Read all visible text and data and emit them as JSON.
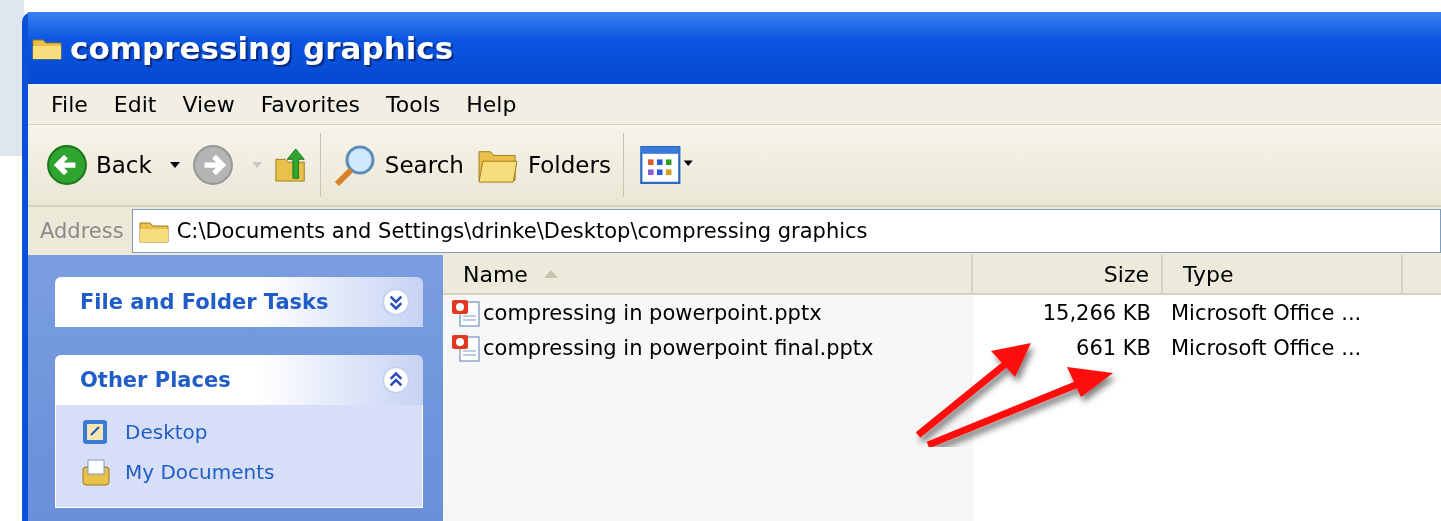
{
  "window": {
    "title": "compressing graphics"
  },
  "menu": [
    "File",
    "Edit",
    "View",
    "Favorites",
    "Tools",
    "Help"
  ],
  "toolbar": [
    {
      "kind": "back",
      "label": "Back"
    },
    {
      "kind": "forward"
    },
    {
      "kind": "up"
    },
    {
      "kind": "search",
      "label": "Search"
    },
    {
      "kind": "folders",
      "label": "Folders"
    },
    {
      "kind": "views"
    }
  ],
  "address": {
    "label": "Address",
    "value": "C:\\Documents and Settings\\drinke\\Desktop\\compressing graphics"
  },
  "sidebar": {
    "sections": [
      {
        "title": "File and Folder Tasks",
        "expanded": false
      },
      {
        "title": "Other Places",
        "expanded": true,
        "items": [
          {
            "label": "Desktop",
            "kind": "desktop"
          },
          {
            "label": "My Documents",
            "kind": "documents"
          }
        ]
      }
    ]
  },
  "table": {
    "columns": [
      {
        "label": "Name",
        "sorted": true
      },
      {
        "label": "Size",
        "sorted": false
      },
      {
        "label": "Type",
        "sorted": false
      }
    ],
    "rows": [
      [
        "compressing in powerpoint.pptx",
        "15,266 KB",
        "Microsoft Office ..."
      ],
      [
        "compressing in powerpoint final.pptx",
        "661 KB",
        "Microsoft Office ..."
      ]
    ]
  },
  "annotation": {
    "kind": "arrows"
  }
}
